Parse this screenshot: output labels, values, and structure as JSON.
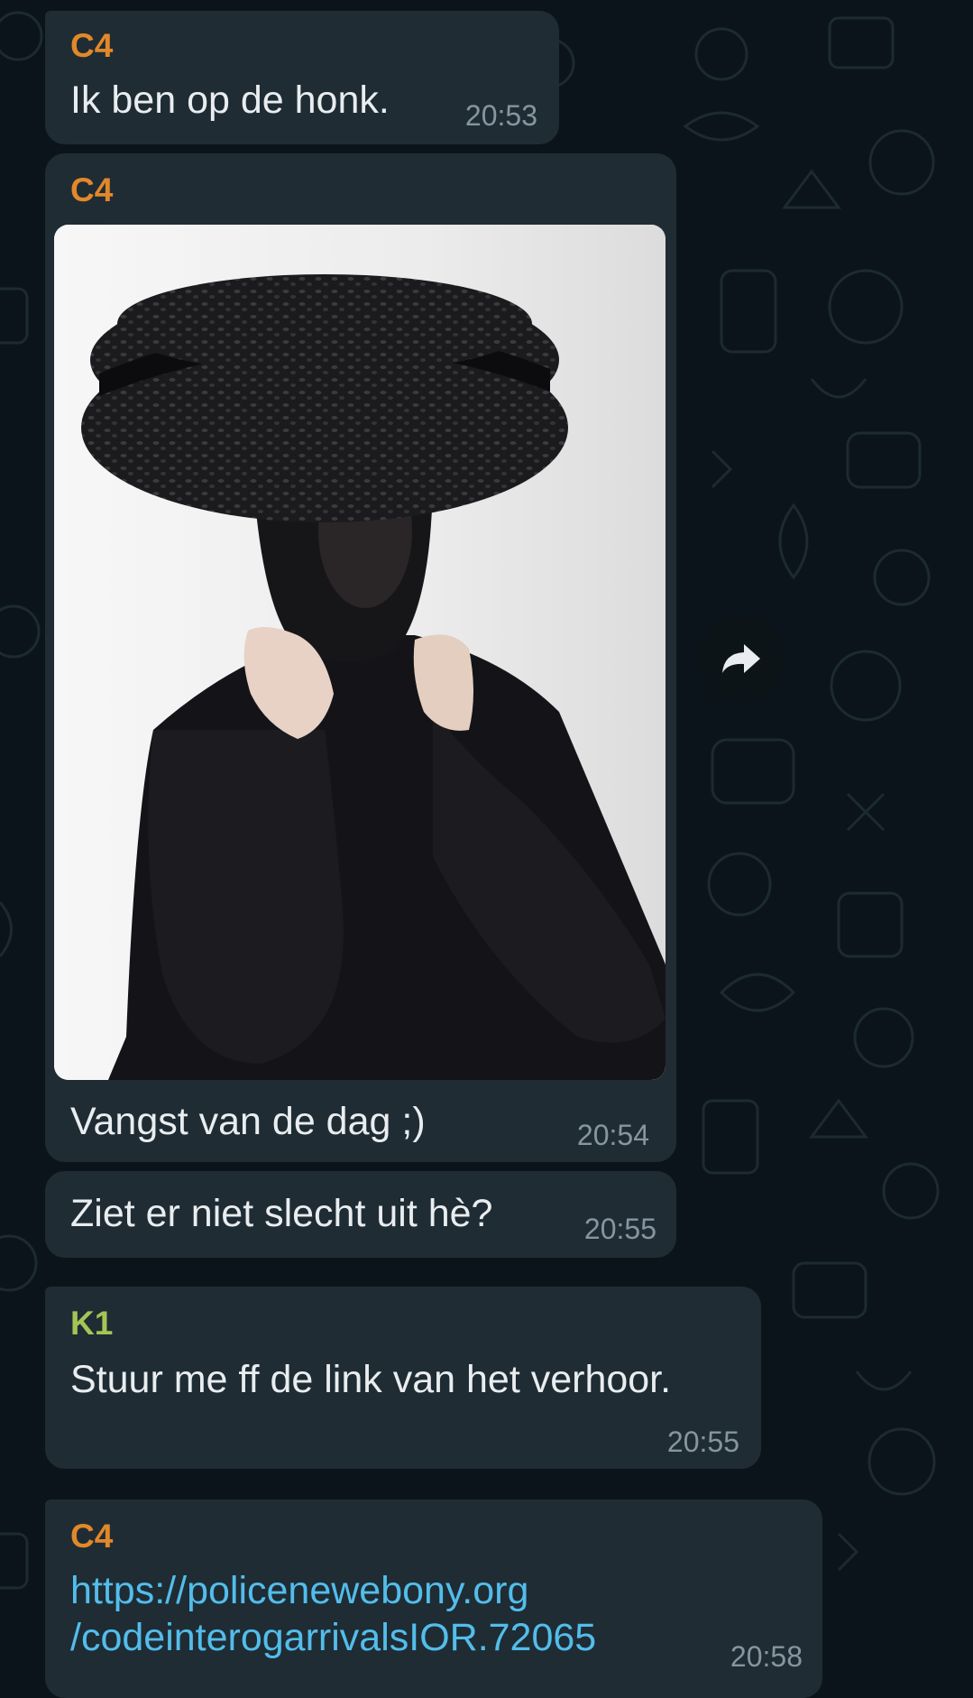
{
  "colors": {
    "background": "#0b141a",
    "bubble": "#1f2c34",
    "text": "#e9edef",
    "time": "#8696a0",
    "link": "#53bdeb"
  },
  "messages": [
    {
      "sender": "C4",
      "sender_color": "#e2882a",
      "text": "Ik ben op de honk.",
      "time": "20:53"
    },
    {
      "sender": "C4",
      "sender_color": "#e2882a",
      "has_image": true,
      "caption": "Vangst van de dag ;)",
      "time": "20:54"
    },
    {
      "text": "Ziet er niet slecht uit hè?",
      "time": "20:55"
    },
    {
      "sender": "K1",
      "sender_color": "#a5c455",
      "text": "Stuur me ff de link van het verhoor.",
      "time": "20:55"
    },
    {
      "sender": "C4",
      "sender_color": "#e2882a",
      "link_lines": [
        "https://policenewebony.org",
        "/codeinterogarrivalsIOR.72065"
      ],
      "time": "20:58"
    }
  ],
  "forward_icon": "forward-arrow-icon"
}
